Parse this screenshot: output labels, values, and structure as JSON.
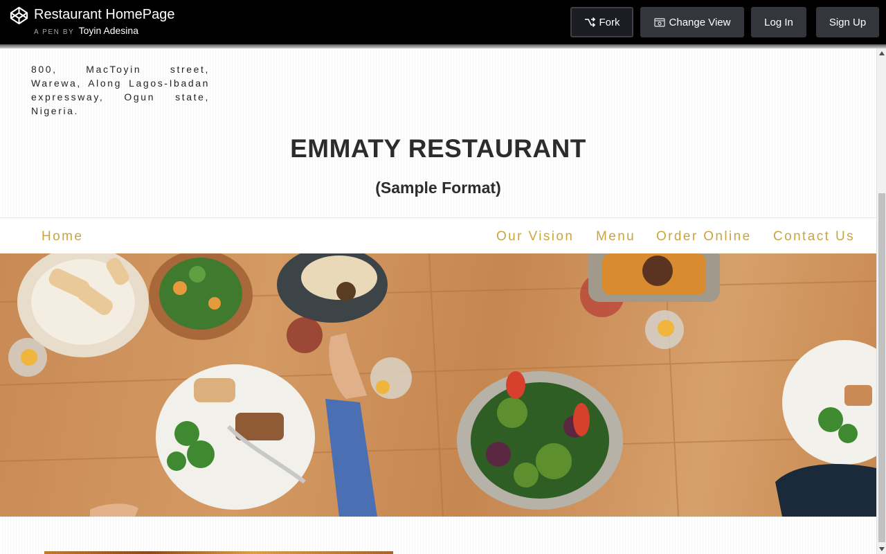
{
  "header": {
    "pen_title": "Restaurant HomePage",
    "byline_prefix": "A PEN BY",
    "author": "Toyin Adesina",
    "buttons": {
      "fork": "Fork",
      "change_view": "Change View",
      "log_in": "Log In",
      "sign_up": "Sign Up"
    }
  },
  "restaurant": {
    "address": "800, MacToyin street, Warewa, Along Lagos-Ibadan expressway, Ogun state, Nigeria.",
    "title": "EMMATY RESTAURANT",
    "subtitle": "(Sample Format)"
  },
  "nav": {
    "home": "Home",
    "our_vision": "Our Vision",
    "menu": "Menu",
    "order_online": "Order Online",
    "contact_us": "Contact Us"
  },
  "colors": {
    "header_bg": "#000000",
    "button_bg": "#34363e",
    "nav_link": "#c9a53f",
    "title_text": "#2c2c2c"
  },
  "icons": [
    "codepen-logo-icon",
    "fork-icon",
    "change-view-icon",
    "scroll-up-icon",
    "scroll-down-icon"
  ]
}
